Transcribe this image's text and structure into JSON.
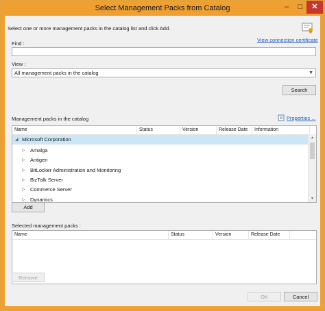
{
  "window": {
    "title": "Select Management Packs from Catalog",
    "minimize_glyph": "–",
    "maximize_glyph": "□",
    "close_glyph": "✕"
  },
  "instruction": "Select one or more management packs in the catalog list and click Add.",
  "certificate": {
    "icon": "certificate-icon",
    "link": "View connection certificate"
  },
  "find": {
    "label": "Find :",
    "value": ""
  },
  "view": {
    "label": "View :",
    "selected": "All management packs in the catalog"
  },
  "search_button": "Search",
  "catalog": {
    "label": "Management packs in the catalog",
    "properties_link": "Properties ...",
    "columns": [
      "Name",
      "Status",
      "Version",
      "Release Date",
      "Information"
    ],
    "group": "Microsoft Corporation",
    "items": [
      "Amalga",
      "Antigen",
      "BitLocker Administration and Monitoring",
      "BizTalk Server",
      "Commerce Server",
      "Dynamics"
    ]
  },
  "add_button": "Add",
  "selected": {
    "label": "Selected management packs :",
    "columns": [
      "Name",
      "Status",
      "Version",
      "Release Date"
    ]
  },
  "remove_button": "Remove",
  "ok_button": "OK",
  "cancel_button": "Cancel",
  "colors": {
    "titlebar": "#f0a030",
    "close": "#c7372f",
    "selection": "#cce6f7",
    "link": "#1f5fbf"
  }
}
